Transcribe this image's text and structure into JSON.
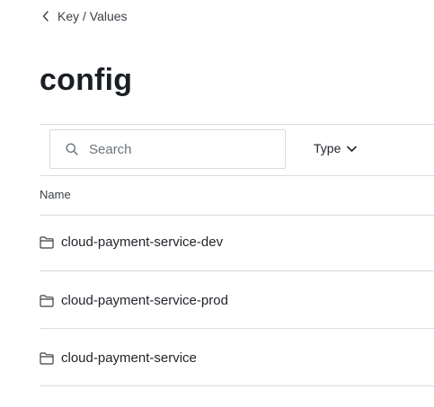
{
  "breadcrumb": {
    "label": "Key / Values"
  },
  "page": {
    "title": "config"
  },
  "search": {
    "placeholder": "Search",
    "value": ""
  },
  "filter": {
    "type_label": "Type"
  },
  "table": {
    "column_header": "Name",
    "rows": [
      {
        "name": "cloud-payment-service-dev",
        "icon": "folder-icon"
      },
      {
        "name": "cloud-payment-service-prod",
        "icon": "folder-icon"
      },
      {
        "name": "cloud-payment-service",
        "icon": "folder-icon"
      }
    ]
  },
  "colors": {
    "text": "#1f2328",
    "muted": "#6a737d",
    "border": "#d7dbe0"
  }
}
